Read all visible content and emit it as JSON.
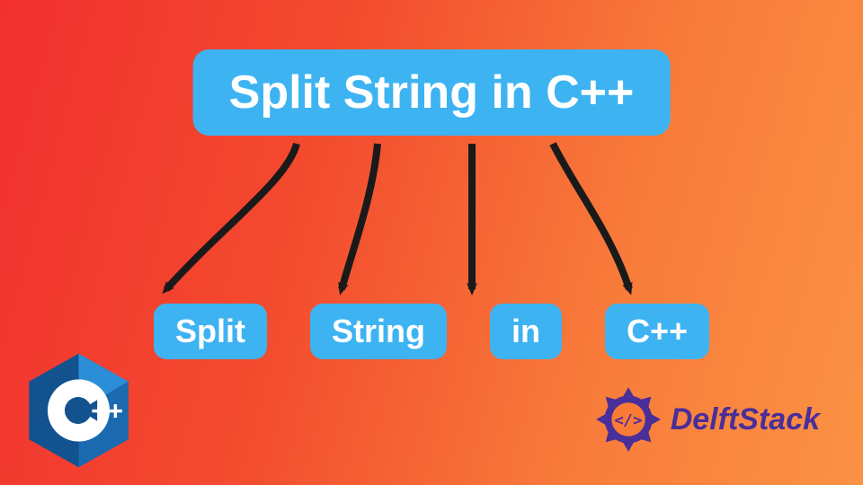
{
  "main": {
    "title": "Split String in C++"
  },
  "tokens": [
    "Split",
    "String",
    "in",
    "C++"
  ],
  "brand": {
    "name": "DelftStack"
  },
  "colors": {
    "pill": "#3eb3f2",
    "text": "#ffffff",
    "brand": "#4a2e99",
    "cpp": "#12528f"
  }
}
